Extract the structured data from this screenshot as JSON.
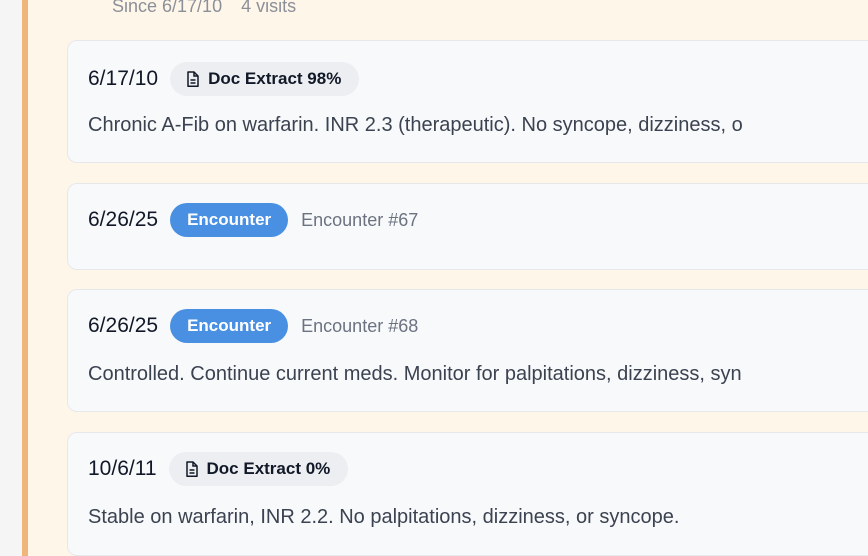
{
  "summary": {
    "since": "Since 6/17/10",
    "visits": "4 visits"
  },
  "entries": [
    {
      "date": "6/17/10",
      "badge": "Doc Extract 98%",
      "badge_type": "doc",
      "note": "Chronic A-Fib on warfarin. INR 2.3 (therapeutic). No syncope, dizziness, o"
    },
    {
      "date": "6/26/25",
      "badge": "Encounter",
      "badge_type": "encounter",
      "encounter_id": "Encounter #67"
    },
    {
      "date": "6/26/25",
      "badge": "Encounter",
      "badge_type": "encounter",
      "encounter_id": "Encounter #68",
      "note": "Controlled. Continue current meds. Monitor for palpitations, dizziness, syn"
    },
    {
      "date": "10/6/11",
      "badge": "Doc Extract 0%",
      "badge_type": "doc",
      "note": "Stable on warfarin, INR 2.2. No palpitations, dizziness, or syncope."
    }
  ],
  "colors": {
    "accent_bar": "#f0b57a",
    "encounter_badge": "#4a90e2",
    "panel_bg": "#fff6ea"
  },
  "icons": {
    "doc_badge_icon": "document-icon"
  }
}
